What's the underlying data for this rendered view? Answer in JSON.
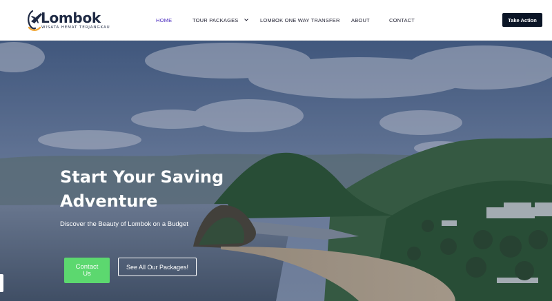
{
  "brand": {
    "name": "Lombok",
    "tagline": "WISATA HEMAT TERJANGKAU",
    "colors": {
      "navy": "#1f2a44",
      "orange": "#f2a93b",
      "plane": "#1f2a44"
    },
    "icon": "plane-logo-icon"
  },
  "nav": {
    "items": [
      {
        "label": "HOME",
        "active": true
      },
      {
        "label": "TOUR PACKAGES",
        "has_dropdown": true
      },
      {
        "label": "LOMBOK ONE WAY TRANSFER"
      },
      {
        "label": "ABOUT"
      },
      {
        "label": "CONTACT"
      }
    ],
    "dropdown_icon": "chevron-down-icon",
    "active_color": "#4a2bbf"
  },
  "header_cta": {
    "label": "Take Action",
    "color": "#0b1526"
  },
  "hero": {
    "title_line1": "Start Your Saving",
    "title_line2": "Adventure",
    "subtitle": "Discover the Beauty of Lombok on a Budget",
    "primary_button": {
      "line1": "Contact",
      "line2": "Us",
      "color": "#5cd86f"
    },
    "secondary_button": {
      "label": "See All Our Packages!"
    }
  }
}
